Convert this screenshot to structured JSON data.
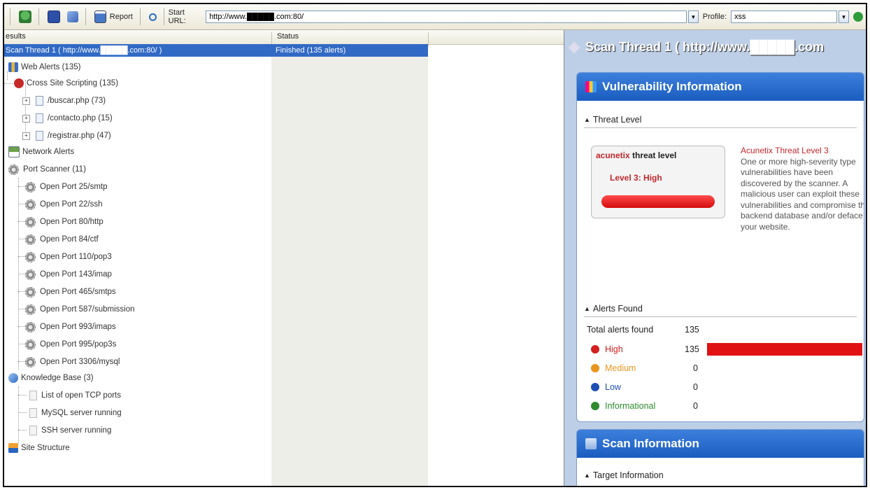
{
  "toolbar": {
    "report_label": "Report",
    "start_url_label": "Start URL:",
    "start_url_value": "http://www.█████.com:80/",
    "profile_label": "Profile:",
    "profile_value": "xss",
    "dropdown_glyph": "▼"
  },
  "left": {
    "col_results": "esults",
    "col_status": "Status",
    "selected_row": {
      "name": "Scan Thread 1 ( http://www.█████.com:80/ )",
      "status": "Finished (135 alerts)"
    },
    "tree": {
      "web_alerts": "Web Alerts (135)",
      "xss": "Cross Site Scripting (135)",
      "files": [
        "/buscar.php (73)",
        "/contacto.php (15)",
        "/registrar.php (47)"
      ],
      "network_alerts": "Network Alerts",
      "port_scanner": "Port Scanner (11)",
      "ports": [
        "Open Port 25/smtp",
        "Open Port 22/ssh",
        "Open Port 80/http",
        "Open Port 84/ctf",
        "Open Port 110/pop3",
        "Open Port 143/imap",
        "Open Port 465/smtps",
        "Open Port 587/submission",
        "Open Port 993/imaps",
        "Open Port 995/pop3s",
        "Open Port 3306/mysql"
      ],
      "knowledge_base": "Knowledge Base (3)",
      "kb_items": [
        "List of open TCP ports",
        "MySQL server running",
        "SSH server running"
      ],
      "site_structure": "Site Structure"
    }
  },
  "right": {
    "title": "Scan Thread 1 ( http://www.█████.com",
    "vuln_panel": {
      "title": "Vulnerability Information",
      "threat_section": "Threat Level",
      "brand": "acunetix",
      "threat_label": "threat level",
      "level_text": "Level 3: High",
      "desc_heading": "Acunetix Threat Level 3",
      "desc_body": "One or more high-severity type vulnerabilities have been discovered by the scanner. A malicious user can exploit these vulnerabilities and compromise the backend database and/or deface your website.",
      "alerts_section": "Alerts Found",
      "total_label": "Total alerts found",
      "total_value": "135",
      "rows": [
        {
          "label": "High",
          "value": "135",
          "color": "#d42020",
          "fraction": 1.0
        },
        {
          "label": "Medium",
          "value": "0",
          "color": "#e8961e",
          "fraction": 0
        },
        {
          "label": "Low",
          "value": "0",
          "color": "#1e50b4",
          "fraction": 0
        },
        {
          "label": "Informational",
          "value": "0",
          "color": "#2e8b2e",
          "fraction": 0
        }
      ]
    },
    "scan_panel": {
      "title": "Scan Information",
      "target_section": "Target Information"
    }
  },
  "colors": {
    "selection": "#316ac5",
    "accent_blue": "#1a5dc0",
    "threat_red": "#c0282d"
  }
}
